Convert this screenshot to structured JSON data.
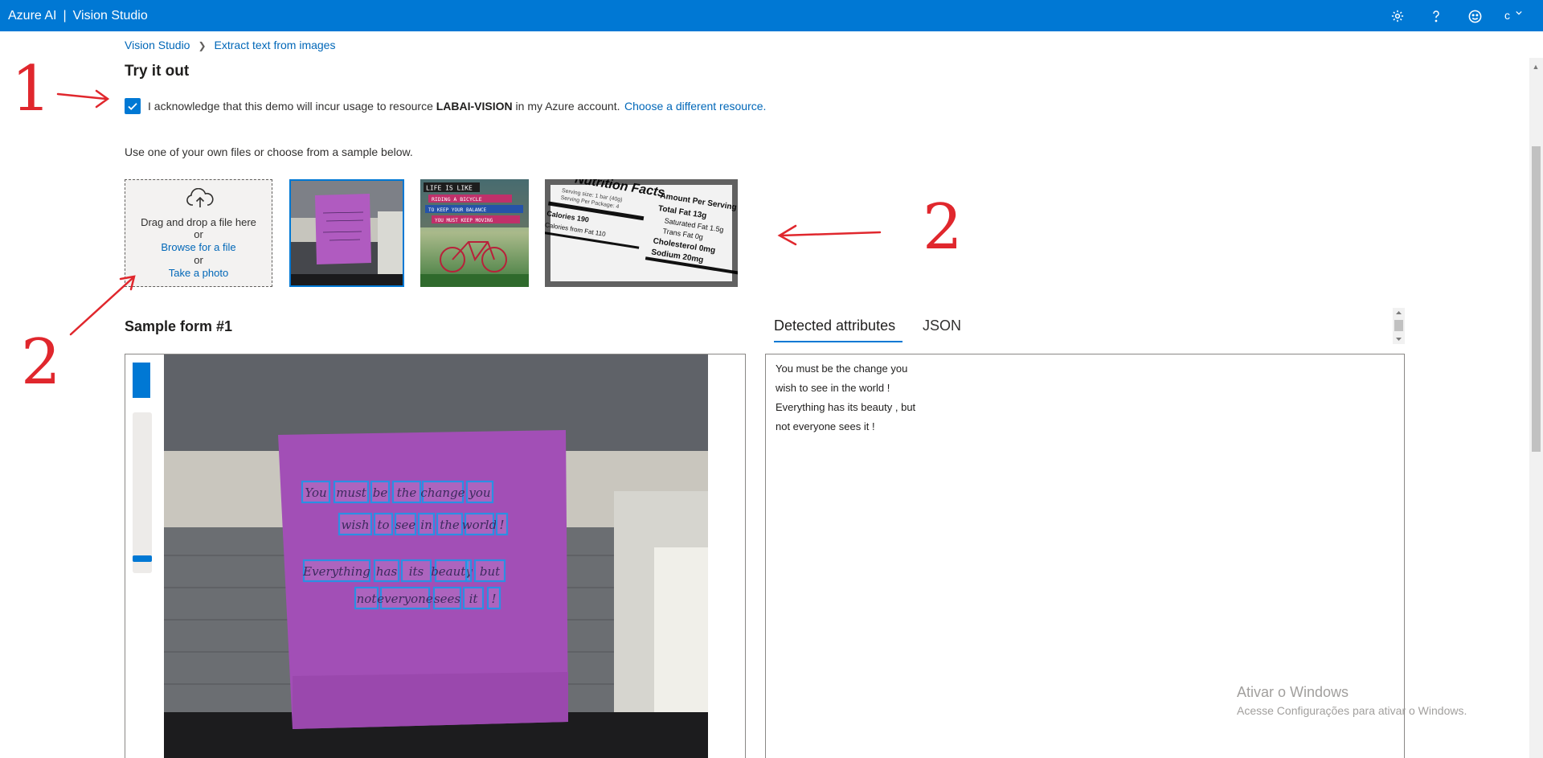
{
  "app": {
    "brand": "Azure AI",
    "separator": "|",
    "product": "Vision Studio",
    "user_initial": "c",
    "accent_color": "#0078d4"
  },
  "header_icons": [
    "settings-gear-icon",
    "help-question-icon",
    "feedback-smiley-icon"
  ],
  "breadcrumb": {
    "items": [
      "Vision Studio",
      "Extract text from images"
    ],
    "separator": ">"
  },
  "page": {
    "title": "Try it out"
  },
  "acknowledge": {
    "checked": true,
    "text_before": "I acknowledge that this demo will incur usage to resource ",
    "resource": "LABAI-VISION",
    "text_after": " in my Azure account.",
    "change_link": "Choose a different resource."
  },
  "sample_picker": {
    "instruction": "Use one of your own files or choose from a sample below.",
    "dropzone": {
      "line1": "Drag and drop a file here",
      "or1": "or",
      "browse": "Browse for a file",
      "or2": "or",
      "photo": "Take a photo"
    },
    "samples": [
      {
        "name": "Sample form #1",
        "selected": true
      },
      {
        "name": "Life is like riding a bicycle",
        "selected": false,
        "text_lines": [
          "LIFE IS LIKE",
          "RIDING A BICYCLE",
          "TO KEEP YOUR BALANCE",
          "YOU MUST KEEP MOVING"
        ]
      },
      {
        "name": "Nutrition facts",
        "selected": false,
        "text_lines": [
          "Nutrition Facts",
          "Amount Per Serving",
          "Total Fat 13g",
          "Saturated Fat 1.5g",
          "Trans Fat 0g",
          "Cholesterol 0mg",
          "Sodium 20mg",
          "Serving size: 1 bar (40g)",
          "Serving Per Package: 4",
          "Calories 190",
          "Calories from Fat 110"
        ]
      }
    ]
  },
  "form_section": {
    "title": "Sample form #1"
  },
  "tabs": [
    {
      "label": "Detected attributes",
      "active": true
    },
    {
      "label": "JSON",
      "active": false
    }
  ],
  "detected_lines": [
    "You must be the change you",
    "wish to see in the world !",
    "Everything has its beauty , but",
    "not everyone sees it !"
  ],
  "detected_words": [
    [
      "You",
      "must",
      "be",
      "the",
      "change",
      "you"
    ],
    [
      "wish",
      "to",
      "see",
      "in",
      "the",
      "world",
      "!"
    ],
    [
      "Everything",
      "has",
      "its",
      "beauty",
      ",",
      "but"
    ],
    [
      "not",
      "everyone",
      "sees",
      "it",
      "!"
    ]
  ],
  "watermark": {
    "line1": "Ativar o Windows",
    "line2": "Acesse Configurações para ativar o Windows."
  },
  "annotations": {
    "color": "#e0272d",
    "labels": [
      "1",
      "2",
      "2"
    ]
  }
}
